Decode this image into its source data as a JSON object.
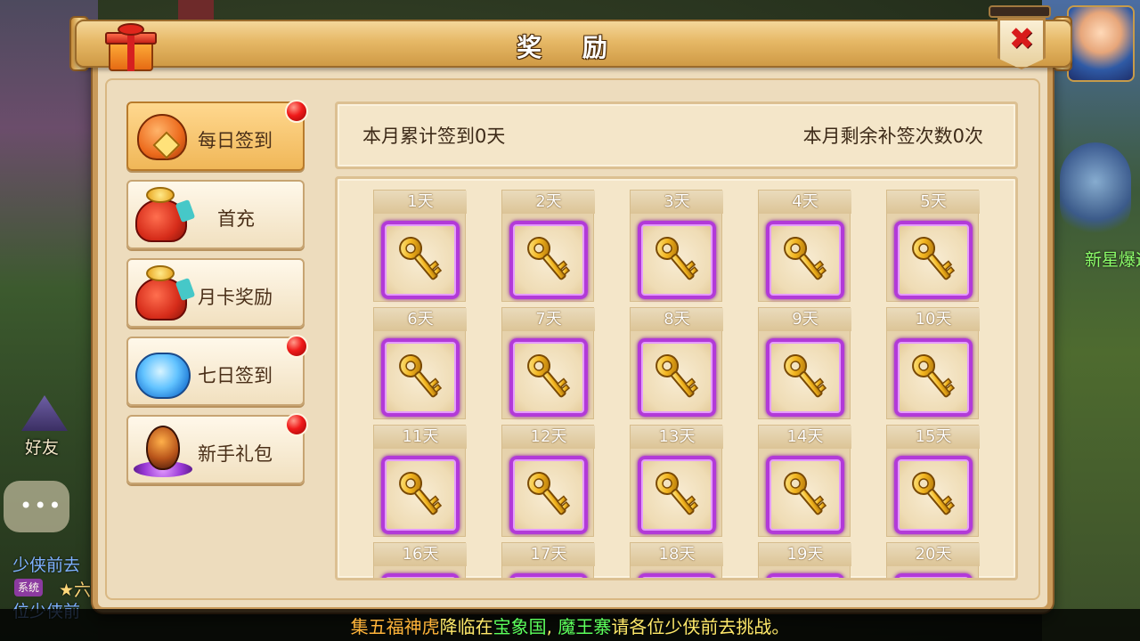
{
  "window": {
    "title": "奖 励",
    "close_icon": "close-x-icon",
    "header_icon": "gift-box-icon"
  },
  "background": {
    "friend_label": "好友",
    "chat_line1": "少侠前去",
    "chat_badge": "系统",
    "chat_line2": "★六",
    "chat_line3": "位少侠前",
    "right_text": "新星爆远征派"
  },
  "nav": {
    "items": [
      {
        "label": "每日签到",
        "icon": "orange-bag-icon",
        "active": true,
        "has_dot": true
      },
      {
        "label": "首充",
        "icon": "red-money-bag-icon",
        "active": false,
        "has_dot": false
      },
      {
        "label": "月卡奖励",
        "icon": "red-money-bag-icon",
        "active": false,
        "has_dot": false
      },
      {
        "label": "七日签到",
        "icon": "blue-treasure-bag-icon",
        "active": false,
        "has_dot": true
      },
      {
        "label": "新手礼包",
        "icon": "dragon-egg-icon",
        "active": false,
        "has_dot": true
      }
    ]
  },
  "info": {
    "monthly_signed": "本月累计签到0天",
    "makeup_remaining": "本月剩余补签次数0次"
  },
  "grid": {
    "days": [
      "1天",
      "2天",
      "3天",
      "4天",
      "5天",
      "6天",
      "7天",
      "8天",
      "9天",
      "10天",
      "11天",
      "12天",
      "13天",
      "14天",
      "15天",
      "16天",
      "17天",
      "18天",
      "19天",
      "20天"
    ],
    "reward_icon": "golden-key-icon"
  },
  "ticker": {
    "parts": [
      {
        "text": "集五福神虎",
        "color": "#ffb43a"
      },
      {
        "text": "降临在",
        "color": "#ffe96a"
      },
      {
        "text": "宝象国",
        "color": "#5cff5c"
      },
      {
        "text": ", ",
        "color": "#ffe96a"
      },
      {
        "text": "魔王寨",
        "color": "#5cff5c"
      },
      {
        "text": "请各位少侠前去挑战。",
        "color": "#ffe96a"
      }
    ]
  },
  "colors": {
    "panel_bg": "#eddcbd",
    "title_gold": "#e6b866",
    "slot_border_purple": "#b23ad8",
    "badge_red": "#f01a1a"
  }
}
